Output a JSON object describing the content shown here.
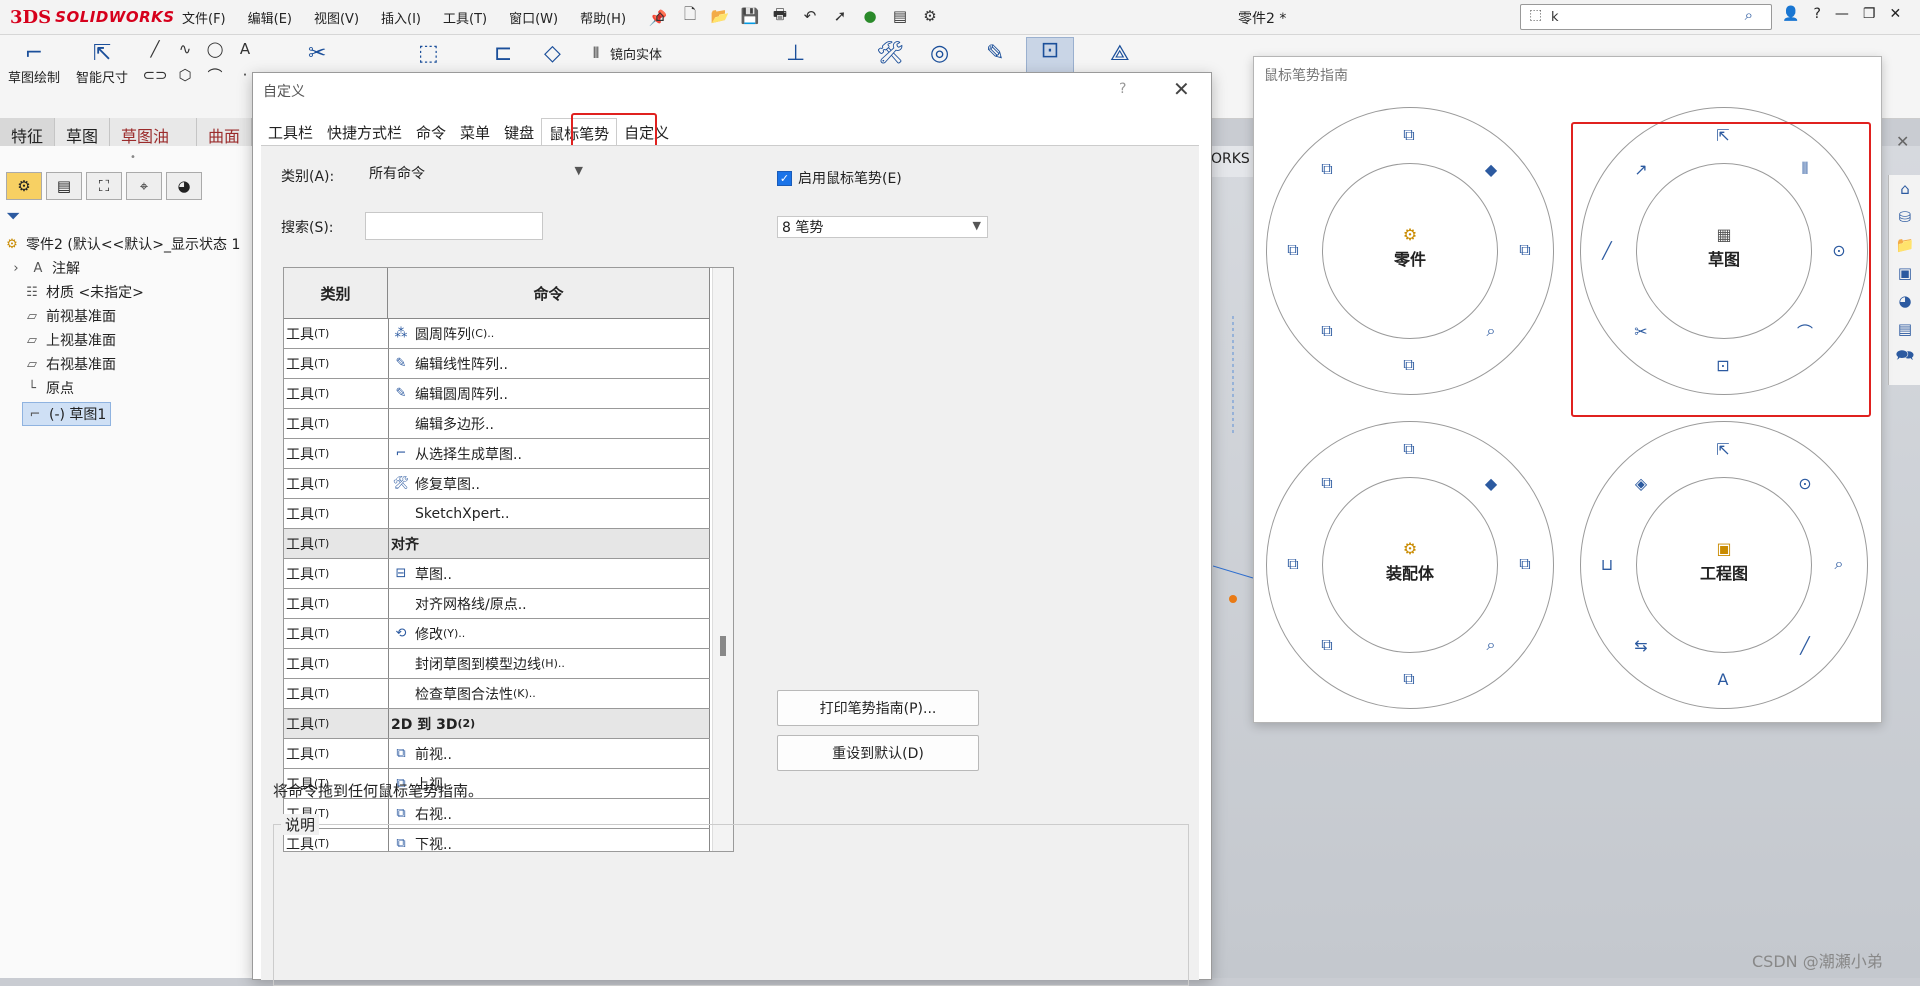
{
  "app": {
    "logo_ds": "3DS",
    "logo_text": "SOLIDWORKS",
    "doc_title": "零件2 *",
    "search_value": "k",
    "menus": [
      "文件(F)",
      "编辑(E)",
      "视图(V)",
      "插入(I)",
      "工具(T)",
      "窗口(W)",
      "帮助(H)"
    ],
    "accent_color": "#d6001c"
  },
  "commandbar": {
    "sketch_label": "草图绘制",
    "smart_dim_label": "智能尺寸",
    "mirror_label": "镜向实体"
  },
  "cm_tabs": [
    "特征",
    "草图",
    "草图油墨",
    "曲面"
  ],
  "tree": {
    "root": "零件2 (默认<<默认>_显示状态 1",
    "items": [
      "注解",
      "材质 <未指定>",
      "前视基准面",
      "上视基准面",
      "右视基准面",
      "原点",
      "(-) 草图1"
    ]
  },
  "graphics_tab_fragment": "ORKS",
  "watermark": "CSDN @潮瀬小弟",
  "dialog": {
    "title": "自定义",
    "help": "?",
    "close": "✕",
    "tabs": [
      "工具栏",
      "快捷方式栏",
      "命令",
      "菜单",
      "键盘",
      "鼠标笔势",
      "自定义"
    ],
    "active_tab": "鼠标笔势",
    "category_label": "类别(A):",
    "category_value": "所有命令",
    "search_label": "搜索(S):",
    "search_value": "",
    "enable_label": "启用鼠标笔势(E)",
    "enable_checked": true,
    "gesture_count": "8 笔势",
    "table": {
      "headers": [
        "类别",
        "命令"
      ],
      "rows": [
        {
          "cat": "工具",
          "sub": "(T)",
          "cmd": "圆周阵列",
          "suffix": "(C)..",
          "icon": "circular-pattern-icon",
          "group": false
        },
        {
          "cat": "工具",
          "sub": "(T)",
          "cmd": "编辑线性阵列..",
          "suffix": "",
          "icon": "edit-linear-pattern-icon",
          "group": false
        },
        {
          "cat": "工具",
          "sub": "(T)",
          "cmd": "编辑圆周阵列..",
          "suffix": "",
          "icon": "edit-circular-pattern-icon",
          "group": false
        },
        {
          "cat": "工具",
          "sub": "(T)",
          "cmd": "编辑多边形..",
          "suffix": "",
          "icon": "",
          "group": false
        },
        {
          "cat": "工具",
          "sub": "(T)",
          "cmd": "从选择生成草图..",
          "suffix": "",
          "icon": "sketch-from-selection-icon",
          "group": false
        },
        {
          "cat": "工具",
          "sub": "(T)",
          "cmd": "修复草图..",
          "suffix": "",
          "icon": "repair-sketch-icon",
          "group": false
        },
        {
          "cat": "工具",
          "sub": "(T)",
          "cmd": "SketchXpert..",
          "suffix": "",
          "icon": "",
          "group": false
        },
        {
          "cat": "工具",
          "sub": "(T)",
          "cmd": "对齐",
          "suffix": "",
          "icon": "",
          "group": true
        },
        {
          "cat": "工具",
          "sub": "(T)",
          "cmd": "草图..",
          "suffix": "",
          "icon": "align-sketch-icon",
          "group": false
        },
        {
          "cat": "工具",
          "sub": "(T)",
          "cmd": "对齐网格线/原点..",
          "suffix": "",
          "icon": "",
          "group": false
        },
        {
          "cat": "工具",
          "sub": "(T)",
          "cmd": "修改",
          "suffix": "(Y)..",
          "icon": "modify-icon",
          "group": false
        },
        {
          "cat": "工具",
          "sub": "(T)",
          "cmd": "封闭草图到模型边线",
          "suffix": "(H)..",
          "icon": "",
          "group": false
        },
        {
          "cat": "工具",
          "sub": "(T)",
          "cmd": "检查草图合法性",
          "suffix": "(K)..",
          "icon": "",
          "group": false
        },
        {
          "cat": "工具",
          "sub": "(T)",
          "cmd": "2D 到 3D",
          "suffix": "(2)",
          "icon": "",
          "group": true
        },
        {
          "cat": "工具",
          "sub": "(T)",
          "cmd": "前视..",
          "suffix": "",
          "icon": "front-view-icon",
          "group": false
        },
        {
          "cat": "工具",
          "sub": "(T)",
          "cmd": "上视..",
          "suffix": "",
          "icon": "top-view-icon",
          "group": false
        },
        {
          "cat": "工具",
          "sub": "(T)",
          "cmd": "右视..",
          "suffix": "",
          "icon": "right-view-icon",
          "group": false
        },
        {
          "cat": "工具",
          "sub": "(T)",
          "cmd": "下视..",
          "suffix": "",
          "icon": "bottom-view-icon",
          "group": false
        }
      ]
    },
    "print_button": "打印笔势指南(P)...",
    "reset_button": "重设到默认(D)",
    "drag_hint": "将命令拖到任何鼠标笔势指南。",
    "description_label": "说明"
  },
  "guide": {
    "title": "鼠标笔势指南",
    "wheels": [
      {
        "label": "零件",
        "icon": "part-icon"
      },
      {
        "label": "草图",
        "icon": "sketch-icon"
      },
      {
        "label": "装配体",
        "icon": "assembly-icon"
      },
      {
        "label": "工程图",
        "icon": "drawing-icon"
      }
    ]
  },
  "highlight_color": "#e0211f"
}
